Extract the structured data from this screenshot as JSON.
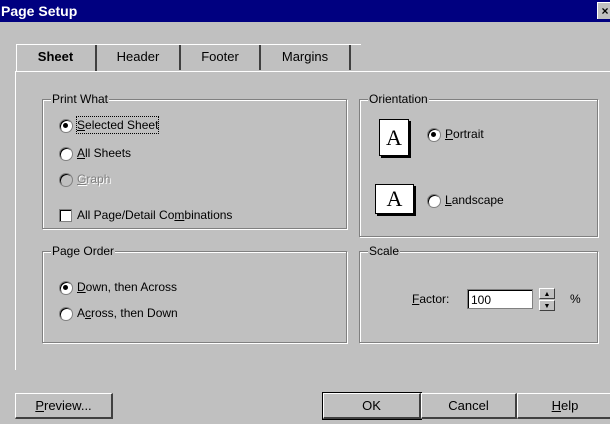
{
  "window": {
    "title": "Page Setup",
    "close_glyph": "×"
  },
  "tabs": [
    {
      "label": "Sheet",
      "active": true
    },
    {
      "label": "Header"
    },
    {
      "label": "Footer"
    },
    {
      "label": "Margins"
    }
  ],
  "print_what": {
    "label": "Print What",
    "options": [
      {
        "pre": "",
        "key": "S",
        "post": "elected Sheet",
        "checked": true
      },
      {
        "pre": "",
        "key": "A",
        "post": "ll Sheets",
        "checked": false
      },
      {
        "pre": "",
        "key": "G",
        "post": "raph",
        "checked": false,
        "disabled": true
      }
    ],
    "checkbox": {
      "pre": "All Page/Detail Co",
      "key": "m",
      "post": "binations",
      "checked": false
    }
  },
  "orientation": {
    "label": "Orientation",
    "icon_letter": "A",
    "options": [
      {
        "pre": "",
        "key": "P",
        "post": "ortrait",
        "checked": true
      },
      {
        "pre": "",
        "key": "L",
        "post": "andscape",
        "checked": false
      }
    ]
  },
  "page_order": {
    "label": "Page Order",
    "options": [
      {
        "pre": "",
        "key": "D",
        "post": "own, then Across",
        "checked": true
      },
      {
        "pre": "A",
        "key": "c",
        "post": "ross, then Down",
        "checked": false
      }
    ]
  },
  "scale": {
    "label": "Scale",
    "factor_pre": "",
    "factor_key": "F",
    "factor_post": "actor:",
    "factor_value": "100",
    "unit": "%"
  },
  "buttons": {
    "preview": {
      "pre": "",
      "key": "P",
      "post": "review..."
    },
    "ok": {
      "label": "OK"
    },
    "cancel": {
      "label": "Cancel"
    },
    "help": {
      "pre": "",
      "key": "H",
      "post": "elp"
    }
  }
}
